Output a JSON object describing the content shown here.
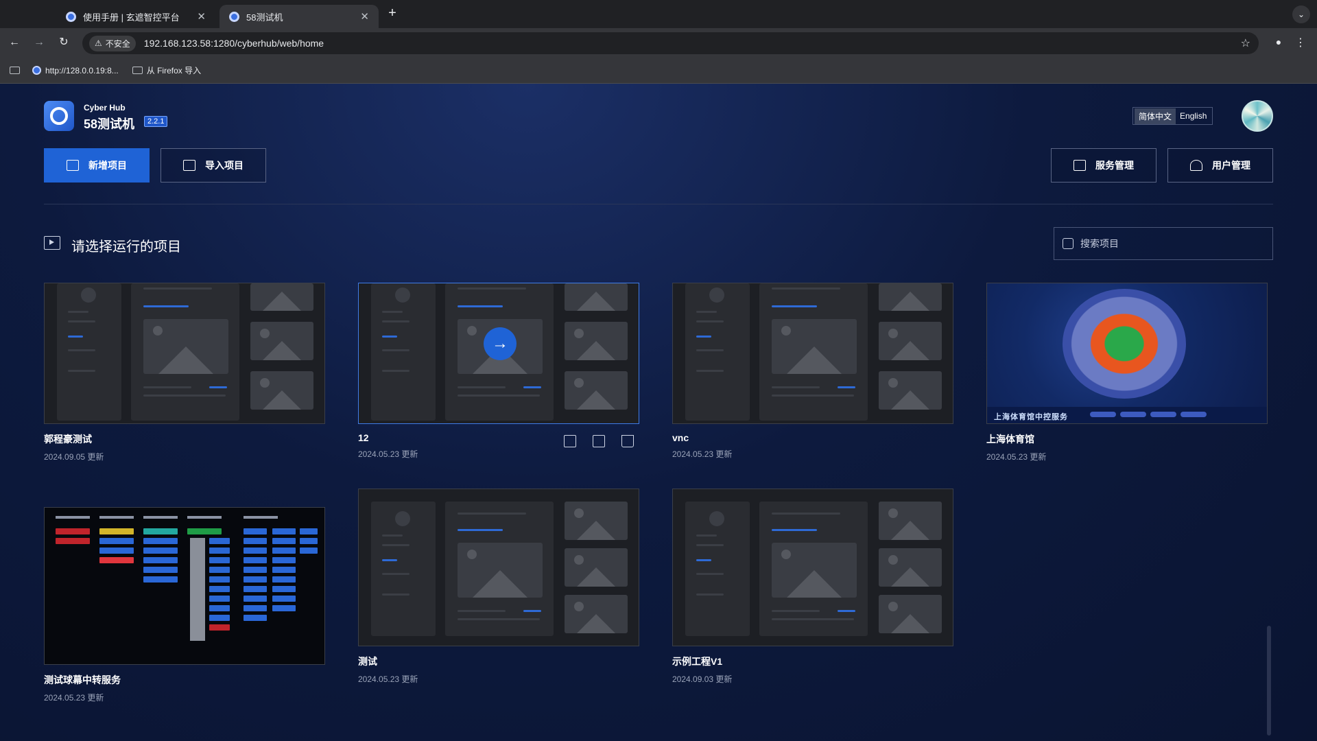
{
  "browser": {
    "tabs": [
      {
        "title": "使用手册 | 玄遮智控平台",
        "active": false
      },
      {
        "title": "58测试机",
        "active": true
      }
    ],
    "security_label": "不安全",
    "url": "192.168.123.58:1280/cyberhub/web/home",
    "bookmarks": [
      {
        "label": "http://128.0.0.19:8..."
      },
      {
        "label": "从 Firefox 导入"
      }
    ]
  },
  "header": {
    "brand_sub": "Cyber Hub",
    "title": "58测试机",
    "version": "2.2.1",
    "lang_zh": "简体中文",
    "lang_en": "English"
  },
  "toolbar": {
    "new_project": "新增项目",
    "import_project": "导入项目",
    "service_mgmt": "服务管理",
    "user_mgmt": "用户管理"
  },
  "section": {
    "title": "请选择运行的项目",
    "search_placeholder": "搜索项目"
  },
  "projects": [
    {
      "name": "郭程豪测试",
      "date": "2024.09.05 更新",
      "thumb": "placeholder"
    },
    {
      "name": "12",
      "date": "2024.05.23 更新",
      "thumb": "placeholder",
      "hovered": true
    },
    {
      "name": "vnc",
      "date": "2024.05.23 更新",
      "thumb": "placeholder"
    },
    {
      "name": "上海体育馆",
      "date": "2024.05.23 更新",
      "thumb": "stadium"
    },
    {
      "name": "测试球幕中转服务",
      "date": "2024.05.23 更新",
      "thumb": "button-panel"
    },
    {
      "name": "测试",
      "date": "2024.05.23 更新",
      "thumb": "placeholder"
    },
    {
      "name": "示例工程V1",
      "date": "2024.09.03 更新",
      "thumb": "placeholder"
    }
  ],
  "stadium_caption": "上海体育馆中控服务",
  "colors": {
    "primary": "#1f63d6",
    "background": "#0b1530",
    "card_border_hover": "#3f7ce8"
  }
}
